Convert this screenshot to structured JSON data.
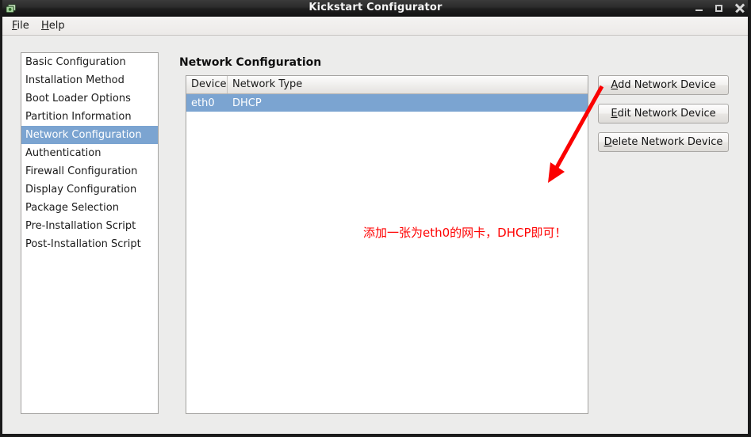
{
  "window": {
    "title": "Kickstart Configurator",
    "icon": "app-icon",
    "controls": {
      "minimize": "minimize-icon",
      "maximize": "maximize-icon",
      "close": "close-icon"
    }
  },
  "menubar": {
    "items": [
      {
        "label": "File",
        "mnemonic": "F",
        "rest": "ile"
      },
      {
        "label": "Help",
        "mnemonic": "H",
        "rest": "elp"
      }
    ]
  },
  "sidebar": {
    "items": [
      {
        "label": "Basic Configuration",
        "selected": false
      },
      {
        "label": "Installation Method",
        "selected": false
      },
      {
        "label": "Boot Loader Options",
        "selected": false
      },
      {
        "label": "Partition Information",
        "selected": false
      },
      {
        "label": "Network Configuration",
        "selected": true
      },
      {
        "label": "Authentication",
        "selected": false
      },
      {
        "label": "Firewall Configuration",
        "selected": false
      },
      {
        "label": "Display Configuration",
        "selected": false
      },
      {
        "label": "Package Selection",
        "selected": false
      },
      {
        "label": "Pre-Installation Script",
        "selected": false
      },
      {
        "label": "Post-Installation Script",
        "selected": false
      }
    ]
  },
  "main": {
    "heading": "Network Configuration",
    "table": {
      "columns": [
        "Device",
        "Network Type"
      ],
      "rows": [
        {
          "device": "eth0",
          "network_type": "DHCP",
          "selected": true
        }
      ]
    },
    "buttons": [
      {
        "mnemonic": "A",
        "rest": "dd Network Device",
        "label": "Add Network Device"
      },
      {
        "mnemonic": "E",
        "rest": "dit Network Device",
        "label": "Edit Network Device"
      },
      {
        "mnemonic": "D",
        "rest": "elete Network Device",
        "label": "Delete Network Device"
      }
    ]
  },
  "annotation": {
    "text": "添加一张为eth0的网卡，DHCP即可！",
    "color": "#ff0000",
    "arrow": "red-arrow"
  },
  "colors": {
    "selection_blue": "#7ba4d1",
    "window_bg": "#ececeb",
    "titlebar_dark": "#1f1f1f",
    "annotation_red": "#ff0000"
  }
}
